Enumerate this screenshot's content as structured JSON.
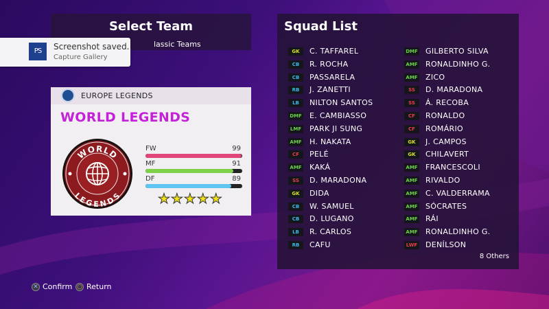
{
  "header": {
    "title": "Select Team",
    "subtitle": "lassic Teams"
  },
  "notification": {
    "title": "Screenshot saved.",
    "subtitle": "Capture Gallery",
    "icon": "playstation-logo"
  },
  "team": {
    "league": "EUROPE LEGENDS",
    "name": "WORLD LEGENDS",
    "badge_top": "WORLD",
    "badge_bottom": "LEGENDS",
    "stats": [
      {
        "label": "FW",
        "value": "99",
        "level": 0.99,
        "color": "#e0467a"
      },
      {
        "label": "MF",
        "value": "91",
        "level": 0.91,
        "color": "#7fd14a"
      },
      {
        "label": "DF",
        "value": "89",
        "level": 0.89,
        "color": "#5fc6f2"
      }
    ],
    "stars": "★★★★★"
  },
  "squad": {
    "title": "Squad List",
    "left": [
      {
        "pos": "GK",
        "name": "C. TAFFAREL"
      },
      {
        "pos": "CB",
        "name": "R. ROCHA"
      },
      {
        "pos": "CB",
        "name": "PASSARELA"
      },
      {
        "pos": "RB",
        "name": "J. ZANETTI"
      },
      {
        "pos": "LB",
        "name": "NILTON SANTOS"
      },
      {
        "pos": "DMF",
        "name": "E. CAMBIASSO"
      },
      {
        "pos": "LMF",
        "name": "PARK JI SUNG"
      },
      {
        "pos": "AMF",
        "name": "H. NAKATA"
      },
      {
        "pos": "CF",
        "name": "PELÉ"
      },
      {
        "pos": "AMF",
        "name": "KAKÁ"
      },
      {
        "pos": "SS",
        "name": "D. MARADONA"
      },
      {
        "pos": "GK",
        "name": "DIDA"
      },
      {
        "pos": "CB",
        "name": "W. SAMUEL"
      },
      {
        "pos": "CB",
        "name": "D. LUGANO"
      },
      {
        "pos": "LB",
        "name": "R. CARLOS"
      },
      {
        "pos": "RB",
        "name": "CAFU"
      }
    ],
    "right": [
      {
        "pos": "DMF",
        "name": "GILBERTO SILVA"
      },
      {
        "pos": "AMF",
        "name": "RONALDINHO G."
      },
      {
        "pos": "AMF",
        "name": "ZICO"
      },
      {
        "pos": "SS",
        "name": "D. MARADONA"
      },
      {
        "pos": "SS",
        "name": "Á. RECOBA"
      },
      {
        "pos": "CF",
        "name": "RONALDO"
      },
      {
        "pos": "CF",
        "name": "ROMÁRIO"
      },
      {
        "pos": "GK",
        "name": "J. CAMPOS"
      },
      {
        "pos": "GK",
        "name": "CHILAVERT"
      },
      {
        "pos": "AMF",
        "name": "FRANCESCOLI"
      },
      {
        "pos": "AMF",
        "name": "RIVALDO"
      },
      {
        "pos": "AMF",
        "name": "C. VALDERRAMA"
      },
      {
        "pos": "AMF",
        "name": "SÓCRATES"
      },
      {
        "pos": "AMF",
        "name": "RÁI"
      },
      {
        "pos": "AMF",
        "name": "RONALDINHO G."
      },
      {
        "pos": "LWF",
        "name": "DENÍLSON"
      }
    ],
    "others": "8 Others"
  },
  "position_colors": {
    "GK": "#d8e22a",
    "CB": "#3ab8e6",
    "RB": "#3ab8e6",
    "LB": "#3ab8e6",
    "DMF": "#6dd24a",
    "LMF": "#6dd24a",
    "AMF": "#6dd24a",
    "CF": "#e8404a",
    "SS": "#e8404a",
    "LWF": "#e8404a"
  },
  "footer": {
    "confirm": "Confirm",
    "return": "Return"
  }
}
